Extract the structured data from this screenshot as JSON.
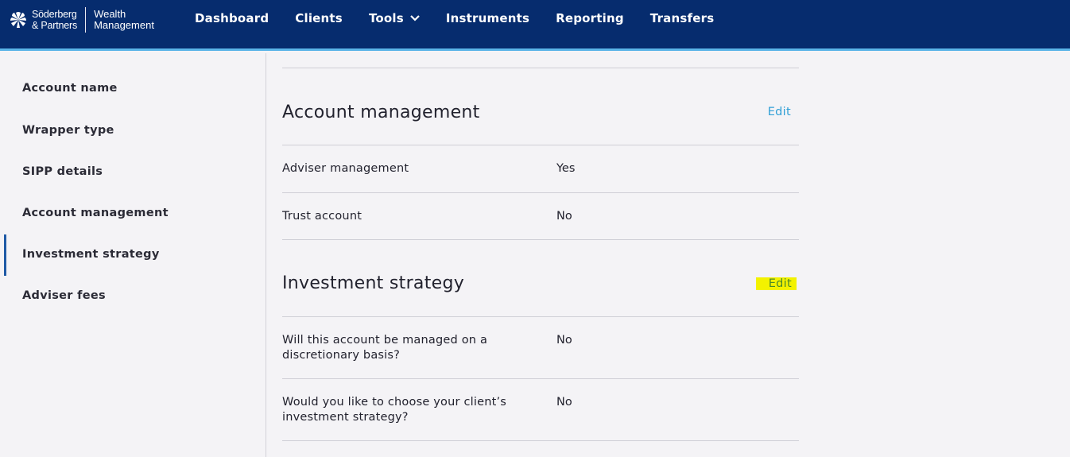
{
  "brand": {
    "name_line1": "Söderberg",
    "name_line2": "& Partners",
    "sub_line1": "Wealth",
    "sub_line2": "Management",
    "logo_icon": "flower-logo-icon"
  },
  "nav": {
    "items": [
      {
        "label": "Dashboard"
      },
      {
        "label": "Clients"
      },
      {
        "label": "Tools",
        "has_dropdown": true
      },
      {
        "label": "Instruments"
      },
      {
        "label": "Reporting"
      },
      {
        "label": "Transfers"
      }
    ]
  },
  "sidebar": {
    "items": [
      {
        "label": "Account name"
      },
      {
        "label": "Wrapper type"
      },
      {
        "label": "SIPP details"
      },
      {
        "label": "Account management"
      },
      {
        "label": "Investment strategy",
        "active": true
      },
      {
        "label": "Adviser fees"
      }
    ]
  },
  "sections": {
    "account_management": {
      "title": "Account management",
      "edit_label": "Edit",
      "rows": [
        {
          "label": "Adviser management",
          "value": "Yes"
        },
        {
          "label": "Trust account",
          "value": "No"
        }
      ]
    },
    "investment_strategy": {
      "title": "Investment strategy",
      "edit_label": "Edit",
      "rows": [
        {
          "label": "Will this account be managed on a discretionary basis?",
          "value": "No"
        },
        {
          "label": "Would you like to choose your client’s investment strategy?",
          "value": "No"
        }
      ]
    }
  },
  "colors": {
    "header_bg": "#062c6e",
    "header_accent": "#5ab4e8",
    "link": "#2f9fd6",
    "highlight": "#f3f200",
    "active_bar": "#1f5aa6"
  }
}
